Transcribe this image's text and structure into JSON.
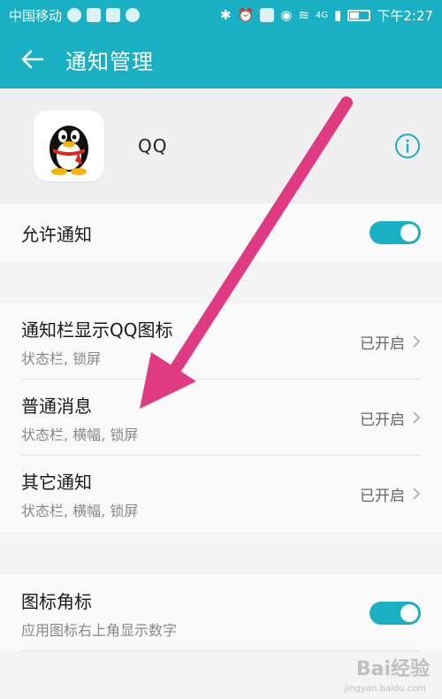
{
  "status_bar": {
    "carrier": "中国移动",
    "network": "4G",
    "time": "下午2:27"
  },
  "app_bar": {
    "title": "通知管理"
  },
  "app_info": {
    "name": "QQ"
  },
  "allow_notifications": {
    "label": "允许通知",
    "enabled": true
  },
  "notification_rows": [
    {
      "title": "通知栏显示QQ图标",
      "subtitle": "状态栏, 锁屏",
      "status": "已开启"
    },
    {
      "title": "普通消息",
      "subtitle": "状态栏, 横幅, 锁屏",
      "status": "已开启"
    },
    {
      "title": "其它通知",
      "subtitle": "状态栏, 横幅, 锁屏",
      "status": "已开启"
    }
  ],
  "badge_row": {
    "title": "图标角标",
    "subtitle": "应用图标右上角显示数字",
    "enabled": true
  },
  "watermark": {
    "text": "Bai经验",
    "url": "jingyan.baidu.com"
  },
  "colors": {
    "accent": "#1ab0c4",
    "arrow": "#e03a82"
  }
}
